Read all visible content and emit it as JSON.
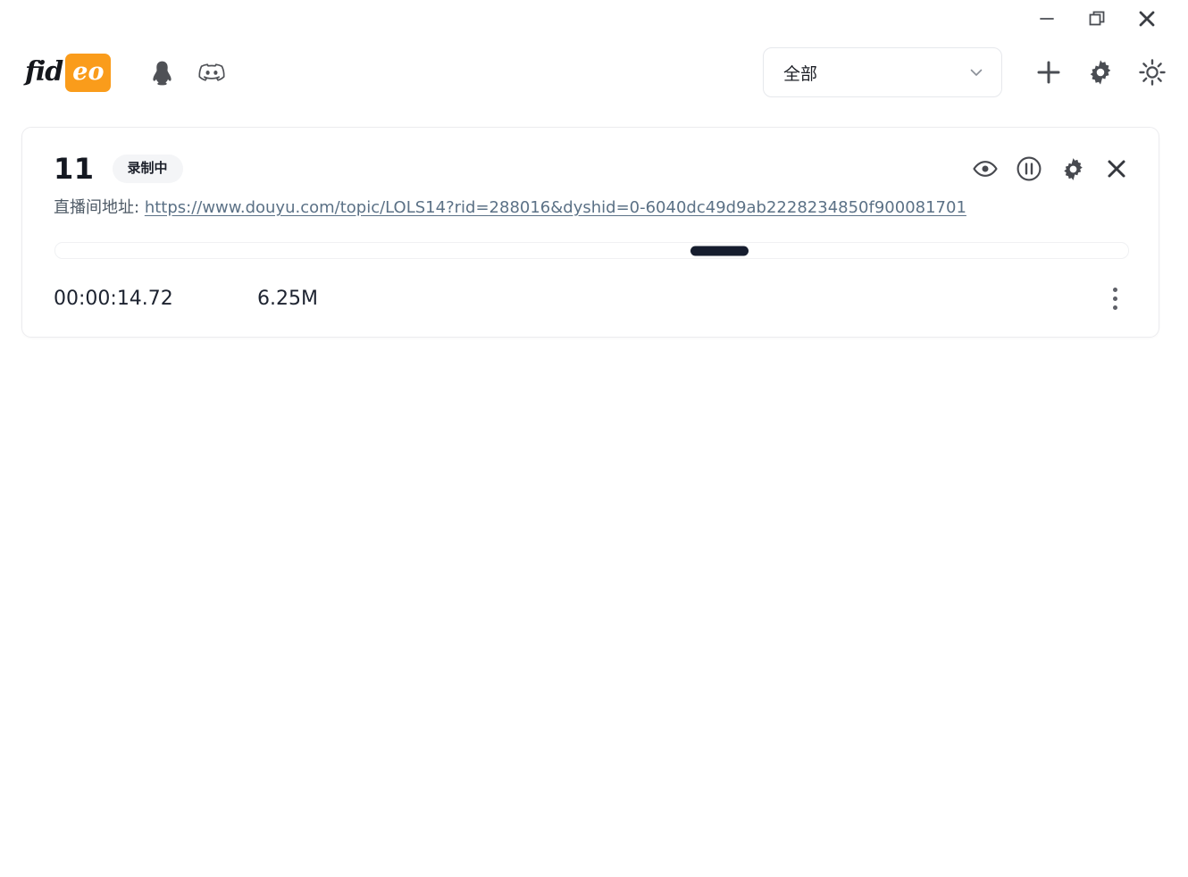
{
  "window": {
    "minimize_label": "Minimize",
    "restore_label": "Restore",
    "close_label": "Close"
  },
  "header": {
    "logo_primary": "fid",
    "logo_accent": "eo",
    "logo_accent_bg": "#fa9c1b",
    "social": [
      {
        "name": "qq-icon",
        "label": "QQ"
      },
      {
        "name": "discord-icon",
        "label": "Discord"
      }
    ],
    "filter": {
      "value": "全部",
      "options": [
        "全部"
      ]
    },
    "actions": [
      {
        "name": "add-icon",
        "label": "新增"
      },
      {
        "name": "settings-icon",
        "label": "设置"
      },
      {
        "name": "theme-icon",
        "label": "主题"
      }
    ]
  },
  "card": {
    "title": "11",
    "status_badge": "录制中",
    "url_label": "直播间地址:",
    "url": "https://www.douyu.com/topic/LOLS14?rid=288016&dyshid=0-6040dc49d9ab2228234850f900081701",
    "actions": [
      {
        "name": "preview-eye-icon",
        "label": "预览"
      },
      {
        "name": "pause-circle-icon",
        "label": "暂停"
      },
      {
        "name": "settings-gear-icon",
        "label": "设置"
      },
      {
        "name": "close-x-icon",
        "label": "关闭"
      }
    ],
    "progress": {
      "handle_position_percent": 59.2,
      "handle_color": "#161d2e"
    },
    "duration": "00:00:14.72",
    "size": "6.25M",
    "more_label": "更多"
  }
}
